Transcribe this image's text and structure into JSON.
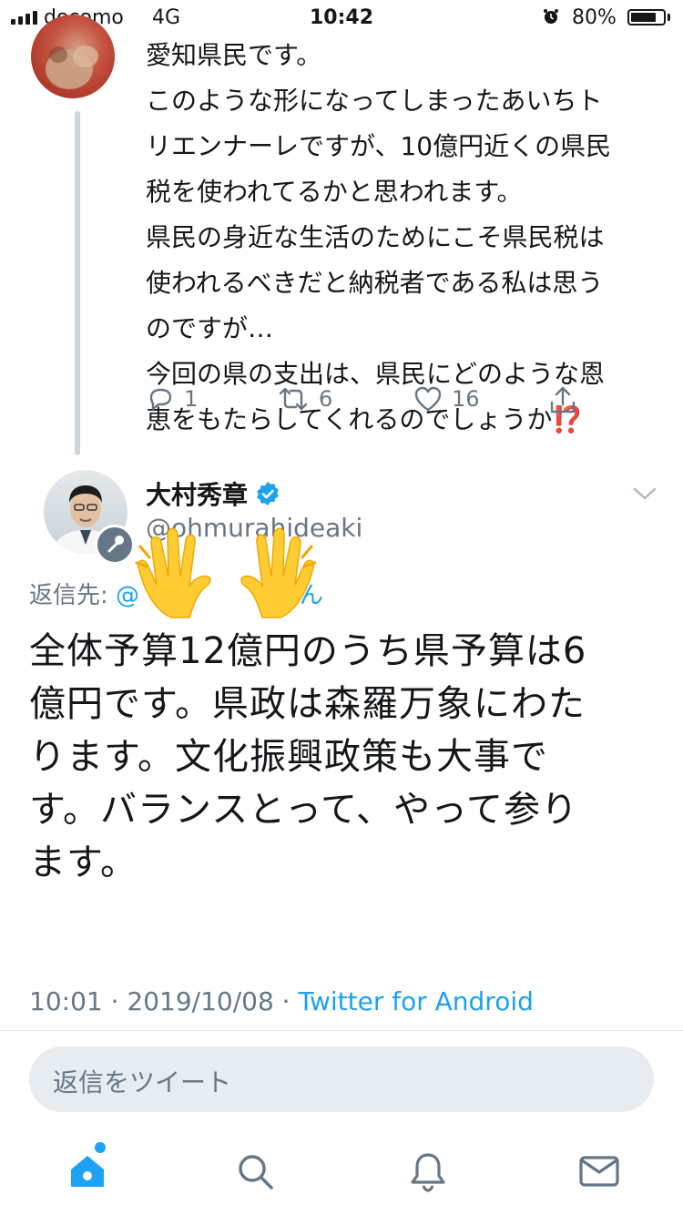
{
  "status_bar": {
    "carrier": "docomo",
    "network": "4G",
    "time": "10:42",
    "battery": "80%",
    "battery_level": 0.8
  },
  "parent_tweet": {
    "text": "愛知県民です。\nこのような形になってしまったあいちト\nリエンナーレですが、10億円近くの県民\n税を使われてるかと思われます。\n県民の身近な生活のためにこそ県民税は\n使われるべきだと納税者である私は思う\nのですが…\n今回の県の支出は、県民にどのような恩\n恵をもたらしてくれるのでしょうか⁉️",
    "actions": {
      "replies": "1",
      "retweets": "6",
      "likes": "16"
    }
  },
  "tweet": {
    "display_name": "大村秀章",
    "handle": "@ohmurahideaki",
    "reply_to_prefix": "返信先: ",
    "reply_to_mention": "@",
    "reply_to_suffix": "さん",
    "text": "全体予算12億円のうち県予算は6\n億円です。県政は森羅万象にわた\nります。文化振興政策も大事で\nす。バランスとって、やって参り\nます。",
    "timestamp": "10:01 · 2019/10/08 · ",
    "source": "Twitter for Android"
  },
  "compose": {
    "placeholder": "返信をツイート"
  },
  "icons": [
    "signal-icon",
    "alarm-icon",
    "battery-icon",
    "reply-icon",
    "retweet-icon",
    "like-icon",
    "share-icon",
    "verified-icon",
    "chevron-down-icon",
    "microphone-icon",
    "raising-hands-emoji",
    "home-icon",
    "search-icon",
    "notifications-icon",
    "messages-icon"
  ],
  "colors": {
    "accent": "#1da1f2",
    "secondary_text": "#657786",
    "primary_text": "#14171a",
    "like_red": "#e0245e"
  }
}
